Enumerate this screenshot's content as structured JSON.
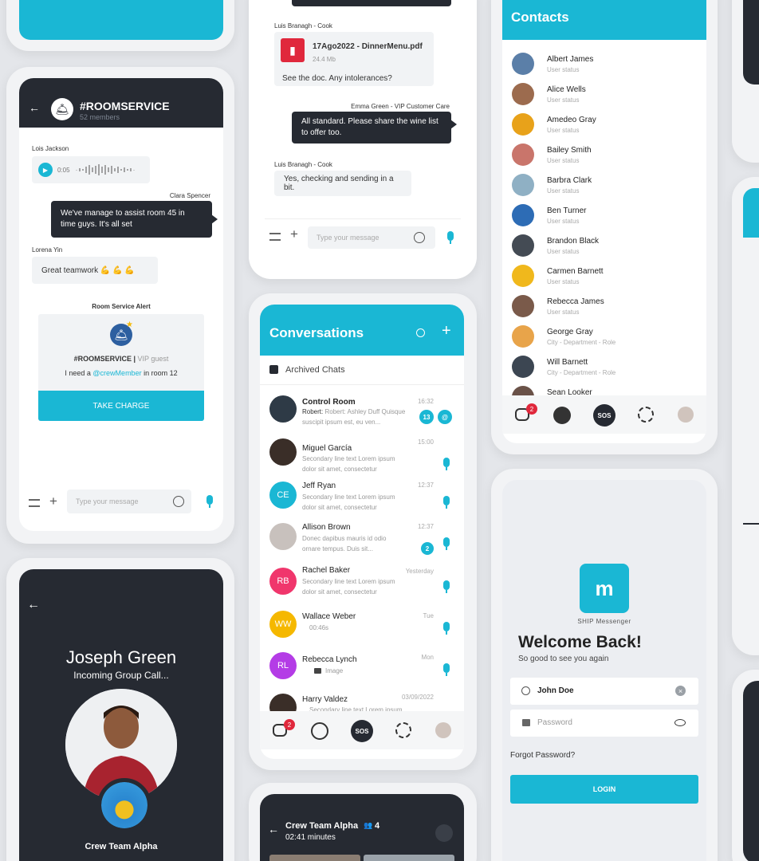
{
  "roomservice": {
    "title": "#ROOMSERVICE",
    "members": "52 members",
    "msg1_sender": "Lois Jackson",
    "msg1_time": "0:05",
    "msg2_sender": "Clara Spencer",
    "msg2_text_l1": "We've manage to assist room 45 in",
    "msg2_text_l2": "time guys.  It's all set",
    "msg3_sender": "Lorena Yin",
    "msg3_text": "Great teamwork 💪 💪 💪",
    "alert_title": "Room Service Alert",
    "alert_channel": "#ROOMSERVICE |",
    "alert_role": "VIP guest",
    "alert_text_pre": "I need a",
    "alert_mention": "@crewMember",
    "alert_text_post": "in room 12",
    "take_charge": "TAKE CHARGE",
    "input_placeholder": "Type your message"
  },
  "chat2": {
    "sender1": "Luis Branagh - Cook",
    "file_name": "17Ago2022 - DinnerMenu.pdf",
    "file_size": "24.4 Mb",
    "msg1": "See the doc. Any intolerances?",
    "sender2": "Emma Green - VIP Customer Care",
    "msg2_l1": "All standard. Please share the wine list",
    "msg2_l2": "to offer too.",
    "sender3": "Luis Branagh - Cook",
    "msg3": "Yes, checking and sending in a bit.",
    "input_placeholder": "Type your message"
  },
  "conversations": {
    "title": "Conversations",
    "archived": "Archived Chats",
    "items": [
      {
        "name": "Control Room",
        "l1": "Robert: Ashley Duff Quisque",
        "l2": "suscipit ipsum est, eu ven...",
        "time": "16:32",
        "badge": "13"
      },
      {
        "name": "Miguel García",
        "l1": "Secondary line text Lorem ipsum",
        "l2": "dolor sit amet, consectetur",
        "time": "15:00"
      },
      {
        "name": "Jeff Ryan",
        "l1": "Secondary line text Lorem ipsum",
        "l2": "dolor sit amet, consectetur",
        "time": "12:37",
        "initials": "CE"
      },
      {
        "name": "Allison Brown",
        "l1": "Donec dapibus mauris id odio",
        "l2": "ornare tempus. Duis sit...",
        "time": "12:37",
        "badge": "2"
      },
      {
        "name": "Rachel Baker",
        "l1": "Secondary line text Lorem ipsum",
        "l2": "dolor sit amet, consectetur",
        "time": "Yesterday",
        "initials": "RB"
      },
      {
        "name": "Wallace Weber",
        "l1": "00:46s",
        "time": "Tue",
        "initials": "WW"
      },
      {
        "name": "Rebecca Lynch",
        "l1": "Image",
        "time": "Mon",
        "initials": "RL"
      },
      {
        "name": "Harry Valdez",
        "l1": "Secondary line text Lorem ipsum",
        "time": "03/09/2022"
      }
    ],
    "nav_badge": "2",
    "sos": "SOS"
  },
  "contacts": {
    "title": "Contacts",
    "items": [
      {
        "name": "Albert James",
        "status": "User status",
        "color": "#5b7fa8"
      },
      {
        "name": "Alice Wells",
        "status": "User status",
        "color": "#9c6b4e"
      },
      {
        "name": "Amedeo Gray",
        "status": "User status",
        "color": "#e8a21a"
      },
      {
        "name": "Bailey Smith",
        "status": "User status",
        "color": "#c9756b"
      },
      {
        "name": "Barbra Clark",
        "status": "User status",
        "color": "#8fb0c4"
      },
      {
        "name": "Ben Turner",
        "status": "User status",
        "color": "#2d6cb5"
      },
      {
        "name": "Brandon Black",
        "status": "User status",
        "color": "#444b54"
      },
      {
        "name": "Carmen Barnett",
        "status": "User status",
        "color": "#f0b81c"
      },
      {
        "name": "Rebecca James",
        "status": "User status",
        "color": "#7a5a4a"
      },
      {
        "name": "George Gray",
        "status": "City - Department - Role",
        "color": "#e8a44a"
      },
      {
        "name": "Will Barnett",
        "status": "City - Department - Role",
        "color": "#3c4652"
      },
      {
        "name": "Sean Looker",
        "status": "",
        "color": "#6a5248"
      }
    ],
    "nav_badge": "2",
    "sos": "SOS"
  },
  "login": {
    "app_name": "SHIP Messenger",
    "welcome": "Welcome Back!",
    "subtitle": "So good to see you again",
    "username": "John Doe",
    "password_placeholder": "Password",
    "forgot": "Forgot Password?",
    "login_button": "LOGIN"
  },
  "call": {
    "name": "Joseph Green",
    "status": "Incoming Group Call...",
    "group": "Crew Team Alpha"
  },
  "group_call": {
    "title": "Crew Team Alpha",
    "count": "4",
    "duration": "02:41 minutes"
  }
}
